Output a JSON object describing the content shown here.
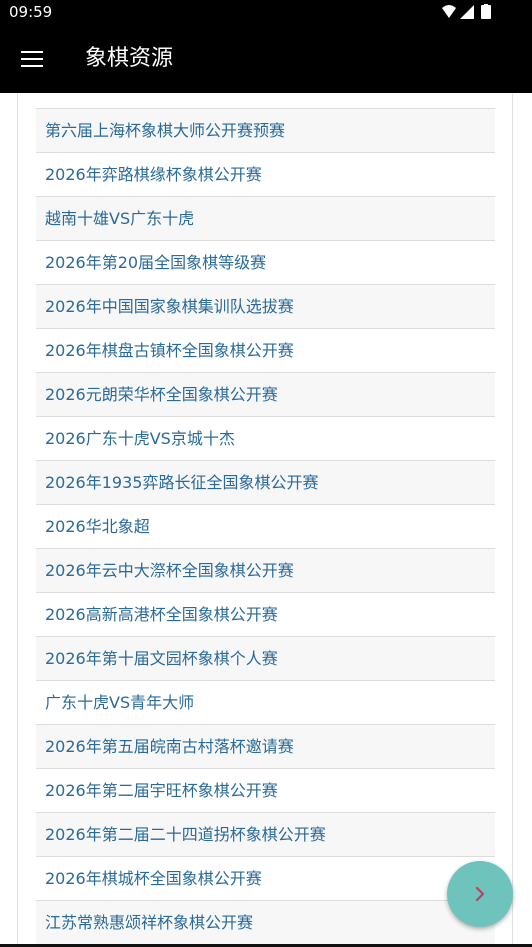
{
  "status_bar": {
    "time": "09:59",
    "icons": [
      "wifi-icon",
      "signal-icon",
      "battery-icon"
    ]
  },
  "app_bar": {
    "title": "象棋资源",
    "menu_icon": "hamburger-menu-icon"
  },
  "list": {
    "items": [
      {
        "label": "第六届上海杯象棋大师公开赛预赛"
      },
      {
        "label": "2026年弈路棋缘杯象棋公开赛"
      },
      {
        "label": "越南十雄VS广东十虎"
      },
      {
        "label": "2026年第20届全国象棋等级赛"
      },
      {
        "label": "2026年中国国家象棋集训队选拔赛"
      },
      {
        "label": "2026年棋盘古镇杯全国象棋公开赛"
      },
      {
        "label": "2026元朗荣华杯全国象棋公开赛"
      },
      {
        "label": "2026广东十虎VS京城十杰"
      },
      {
        "label": "2026年1935弈路长征全国象棋公开赛"
      },
      {
        "label": "2026华北象超"
      },
      {
        "label": "2026年云中大漈杯全国象棋公开赛"
      },
      {
        "label": "2026高新高港杯全国象棋公开赛"
      },
      {
        "label": "2026年第十届文园杯象棋个人赛"
      },
      {
        "label": "广东十虎VS青年大师"
      },
      {
        "label": "2026年第五届皖南古村落杯邀请赛"
      },
      {
        "label": "2026年第二届宇旺杯象棋公开赛"
      },
      {
        "label": "2026年第二届二十四道拐杯象棋公开赛"
      },
      {
        "label": "2026年棋城杯全国象棋公开赛"
      },
      {
        "label": "江苏常熟惠颂祥杯象棋公开赛"
      }
    ]
  },
  "fab": {
    "icon": "chevron-right-icon",
    "color": "#6fc3bd"
  },
  "colors": {
    "link": "#2a6a9a",
    "app_bar": "#000000",
    "divider": "#dddddd"
  }
}
